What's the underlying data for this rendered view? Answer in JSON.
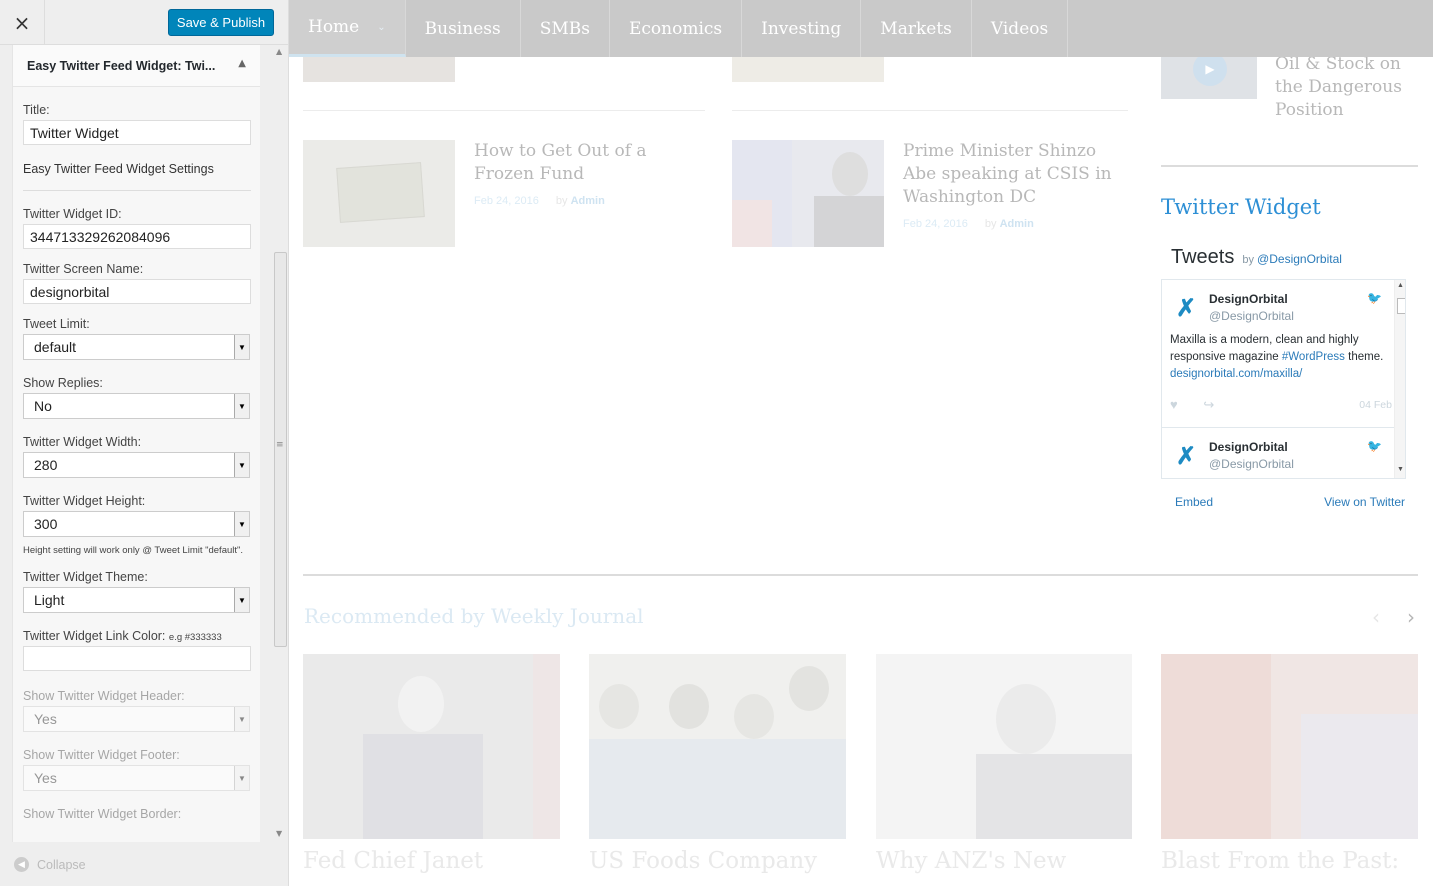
{
  "sidebar": {
    "close_icon": "×",
    "save_label": "Save & Publish",
    "widget_title": "Easy Twitter Feed Widget: Twi...",
    "title_label": "Title:",
    "title_value": "Twitter Widget",
    "settings_heading": "Easy Twitter Feed Widget Settings",
    "widget_id_label": "Twitter Widget ID:",
    "widget_id_value": "344713329262084096",
    "screen_name_label": "Twitter Screen Name:",
    "screen_name_value": "designorbital",
    "tweet_limit_label": "Tweet Limit:",
    "tweet_limit_value": "default",
    "show_replies_label": "Show Replies:",
    "show_replies_value": "No",
    "width_label": "Twitter Widget Width:",
    "width_value": "280",
    "height_label": "Twitter Widget Height:",
    "height_value": "300",
    "height_note": "Height setting will work only @ Tweet Limit \"default\".",
    "theme_label": "Twitter Widget Theme:",
    "theme_value": "Light",
    "link_color_label": "Twitter Widget Link Color:",
    "link_color_hint": "e.g #333333",
    "link_color_value": "",
    "show_header_label": "Show Twitter Widget Header:",
    "show_header_value": "Yes",
    "show_footer_label": "Show Twitter Widget Footer:",
    "show_footer_value": "Yes",
    "show_border_label": "Show Twitter Widget Border:",
    "collapse_label": "Collapse"
  },
  "nav": {
    "items": [
      "Home",
      "Business",
      "SMBs",
      "Economics",
      "Investing",
      "Markets",
      "Videos"
    ],
    "active": "Home"
  },
  "articles": [
    {
      "title": "How to Get Out of a Frozen Fund",
      "date": "Feb 24, 2016",
      "by": "by",
      "author": "Admin"
    },
    {
      "title": "Prime Minister Shinzo Abe speaking at CSIS in Washington DC",
      "date": "Feb 24, 2016",
      "by": "by",
      "author": "Admin"
    }
  ],
  "side_article": {
    "title": "Oil & Stock on the Dangerous Position"
  },
  "twitter_widget": {
    "heading": "Twitter Widget",
    "tweets_label": "Tweets",
    "by_label": "by",
    "handle": "@DesignOrbital",
    "tweets": [
      {
        "name": "DesignOrbital",
        "user": "@DesignOrbital",
        "text_1": "Maxilla is a modern, clean and highly responsive magazine ",
        "hashtag": "#WordPress",
        "text_2": " theme. ",
        "link": "designorbital.com/maxilla/",
        "date": "04 Feb"
      },
      {
        "name": "DesignOrbital",
        "user": "@DesignOrbital"
      }
    ],
    "embed_label": "Embed",
    "view_label": "View on Twitter"
  },
  "recommended": {
    "heading": "Recommended by Weekly Journal",
    "prev_icon": "‹",
    "next_icon": "›",
    "items": [
      "Fed Chief Janet",
      "US Foods Company",
      "Why ANZ's New",
      "Blast From the Past:"
    ]
  }
}
